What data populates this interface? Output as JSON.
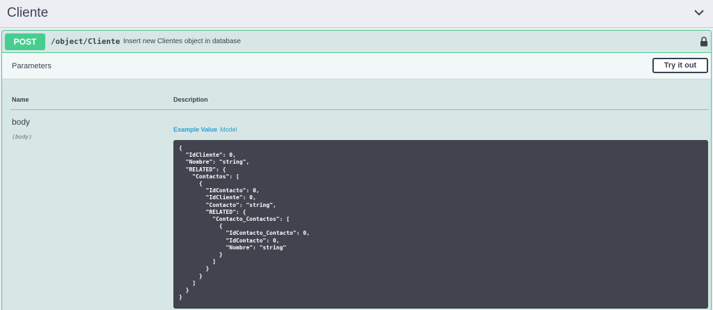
{
  "tag": {
    "title": "Cliente",
    "chevron_icon": "chevron-down-icon"
  },
  "operation": {
    "method": "POST",
    "path": "/object/Cliente",
    "summary": "Insert new Clientes object in database",
    "lock_icon": "lock-icon",
    "method_color": "#49cc90"
  },
  "parameters": {
    "title": "Parameters",
    "try_label": "Try it out",
    "col_name": "Name",
    "col_description": "Description",
    "items": [
      {
        "name": "body",
        "in": "(body)",
        "tabs": {
          "example": "Example Value",
          "model": "Model"
        },
        "example_lines": [
          "{",
          "  \"IdCliente\": 0,",
          "  \"Nombre\": \"string\",",
          "  \"RELATED\": {",
          "    \"Contactos\": [",
          "      {",
          "        \"IdContacto\": 0,",
          "        \"IdCliente\": 0,",
          "        \"Contacto\": \"string\",",
          "        \"RELATED\": {",
          "          \"Contacto_Contactos\": [",
          "            {",
          "              \"IdContacto_Contacto\": 0,",
          "              \"IdContacto\": 0,",
          "              \"Nombre\": \"string\"",
          "            }",
          "          ]",
          "        }",
          "      }",
          "    ]",
          "  }",
          "}"
        ]
      }
    ]
  }
}
